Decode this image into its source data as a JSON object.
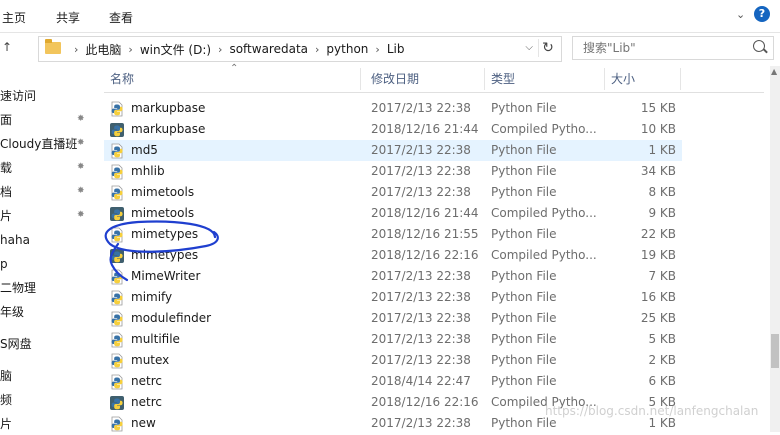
{
  "ribbon": {
    "tabs": [
      "主页",
      "共享",
      "查看"
    ],
    "help": "?"
  },
  "address": {
    "crumbs": [
      "此电脑",
      "win文件 (D:)",
      "softwaredata",
      "python",
      "Lib"
    ],
    "search_placeholder": "搜索\"Lib\""
  },
  "nav": {
    "items": [
      {
        "label": "速访问",
        "pinned": false
      },
      {
        "label": "面",
        "pinned": true
      },
      {
        "label": "Cloudy直播班",
        "pinned": true
      },
      {
        "label": "载",
        "pinned": true
      },
      {
        "label": "档",
        "pinned": true
      },
      {
        "label": "片",
        "pinned": true
      },
      {
        "label": "haha",
        "pinned": false
      },
      {
        "label": "p",
        "pinned": false
      },
      {
        "label": "二物理",
        "pinned": false
      },
      {
        "label": "年级",
        "pinned": false
      },
      {
        "label": "S网盘",
        "pinned": false
      },
      {
        "label": "脑",
        "pinned": false
      },
      {
        "label": "频",
        "pinned": false
      },
      {
        "label": "片",
        "pinned": false
      }
    ]
  },
  "columns": {
    "name": "名称",
    "date": "修改日期",
    "type": "类型",
    "size": "大小"
  },
  "files": [
    {
      "name": "markupbase",
      "date": "2017/2/13 22:38",
      "type": "Python File",
      "size": "15 KB",
      "icon": "python-file-icon",
      "selected": false
    },
    {
      "name": "markupbase",
      "date": "2018/12/16 21:44",
      "type": "Compiled Pytho...",
      "size": "10 KB",
      "icon": "compiled-python-icon",
      "selected": false
    },
    {
      "name": "md5",
      "date": "2017/2/13 22:38",
      "type": "Python File",
      "size": "1 KB",
      "icon": "python-file-icon",
      "selected": true
    },
    {
      "name": "mhlib",
      "date": "2017/2/13 22:38",
      "type": "Python File",
      "size": "34 KB",
      "icon": "python-file-icon",
      "selected": false
    },
    {
      "name": "mimetools",
      "date": "2017/2/13 22:38",
      "type": "Python File",
      "size": "8 KB",
      "icon": "python-file-icon",
      "selected": false
    },
    {
      "name": "mimetools",
      "date": "2018/12/16 21:44",
      "type": "Compiled Pytho...",
      "size": "9 KB",
      "icon": "compiled-python-icon",
      "selected": false
    },
    {
      "name": "mimetypes",
      "date": "2018/12/16 21:55",
      "type": "Python File",
      "size": "22 KB",
      "icon": "python-file-icon",
      "selected": false
    },
    {
      "name": "mimetypes",
      "date": "2018/12/16 22:16",
      "type": "Compiled Pytho...",
      "size": "19 KB",
      "icon": "compiled-python-icon",
      "selected": false
    },
    {
      "name": "MimeWriter",
      "date": "2017/2/13 22:38",
      "type": "Python File",
      "size": "7 KB",
      "icon": "python-file-icon",
      "selected": false
    },
    {
      "name": "mimify",
      "date": "2017/2/13 22:38",
      "type": "Python File",
      "size": "16 KB",
      "icon": "python-file-icon",
      "selected": false
    },
    {
      "name": "modulefinder",
      "date": "2017/2/13 22:38",
      "type": "Python File",
      "size": "25 KB",
      "icon": "python-file-icon",
      "selected": false
    },
    {
      "name": "multifile",
      "date": "2017/2/13 22:38",
      "type": "Python File",
      "size": "5 KB",
      "icon": "python-file-icon",
      "selected": false
    },
    {
      "name": "mutex",
      "date": "2017/2/13 22:38",
      "type": "Python File",
      "size": "2 KB",
      "icon": "python-file-icon",
      "selected": false
    },
    {
      "name": "netrc",
      "date": "2018/4/14 22:47",
      "type": "Python File",
      "size": "6 KB",
      "icon": "python-file-icon",
      "selected": false
    },
    {
      "name": "netrc",
      "date": "2018/12/16 22:16",
      "type": "Compiled Pytho...",
      "size": "5 KB",
      "icon": "compiled-python-icon",
      "selected": false
    },
    {
      "name": "new",
      "date": "2017/2/13 22:38",
      "type": "Python File",
      "size": "1 KB",
      "icon": "python-file-icon",
      "selected": false
    }
  ],
  "watermark": "https://blog.csdn.net/lanfengchalan",
  "colors": {
    "annotation": "#1f3fcf",
    "selection": "#e5f3ff",
    "header_text": "#4d6082",
    "python_blue": "#3872a6",
    "python_yellow": "#f6cf3c"
  }
}
